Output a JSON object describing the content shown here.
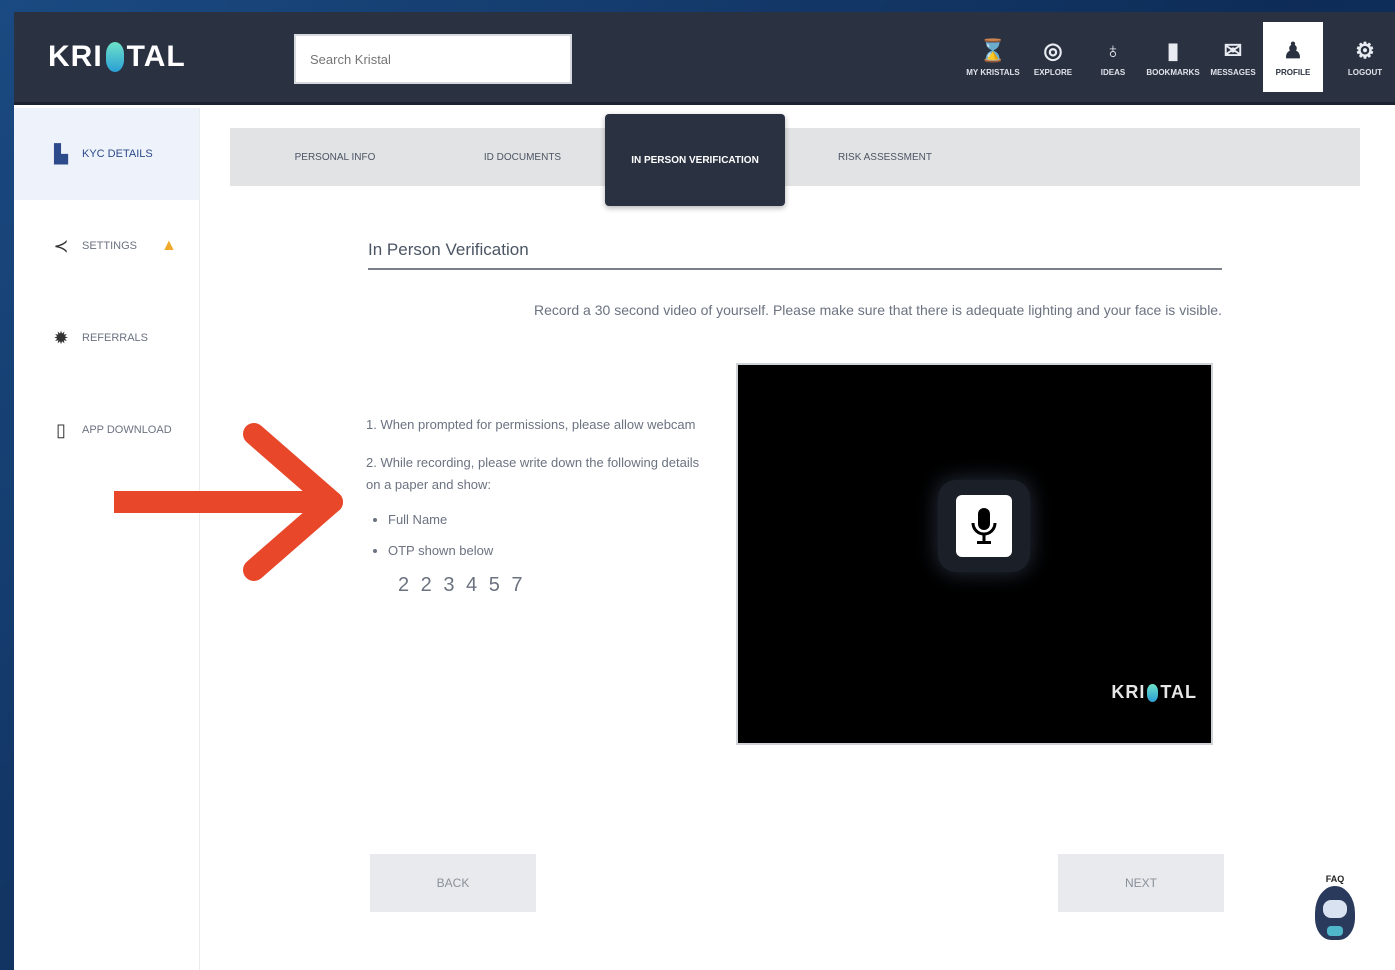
{
  "brand": {
    "logo_left": "KRI",
    "logo_right": "TAL"
  },
  "search": {
    "placeholder": "Search Kristal"
  },
  "nav": [
    {
      "label": "My Kristals",
      "icon": "hourglass-icon"
    },
    {
      "label": "Explore",
      "icon": "globe-icon"
    },
    {
      "label": "Ideas",
      "icon": "lightbulb-icon"
    },
    {
      "label": "Bookmarks",
      "icon": "bookmark-icon"
    },
    {
      "label": "Messages",
      "icon": "mail-icon"
    },
    {
      "label": "Profile",
      "icon": "user-icon"
    },
    {
      "label": "Logout",
      "icon": "gear-icon"
    }
  ],
  "sidebar": [
    {
      "label": "KYC Details",
      "icon": "document-icon"
    },
    {
      "label": "Settings",
      "icon": "share-icon",
      "warning": "warning-icon"
    },
    {
      "label": "Referrals",
      "icon": "gift-icon"
    },
    {
      "label": "App Download",
      "icon": "phone-icon"
    }
  ],
  "tabs": [
    "Personal Info",
    "ID Documents",
    "In Person Verification",
    "Risk Assessment"
  ],
  "active_tab": 2,
  "section": {
    "title": "In Person Verification",
    "instruction": "Record a 30 second video of yourself. Please make sure that there is adequate lighting and your face is visible."
  },
  "steps": {
    "step1": "1. When prompted for permissions, please allow webcam",
    "step2": "2. While recording, please write down the following details on a paper and show:",
    "bullets": [
      "Full Name",
      "OTP shown below"
    ],
    "otp": "2 2 3 4 5 7"
  },
  "video": {
    "logo_left": "KRI",
    "logo_right": "TAL",
    "record_icon": "microphone-icon"
  },
  "buttons": {
    "back": "Back",
    "next": "Next"
  },
  "chatbot": {
    "label": "FAQ"
  },
  "colors": {
    "header": "#2a3140",
    "annotation_arrow": "#e8472a",
    "warning": "#f0a92a"
  }
}
